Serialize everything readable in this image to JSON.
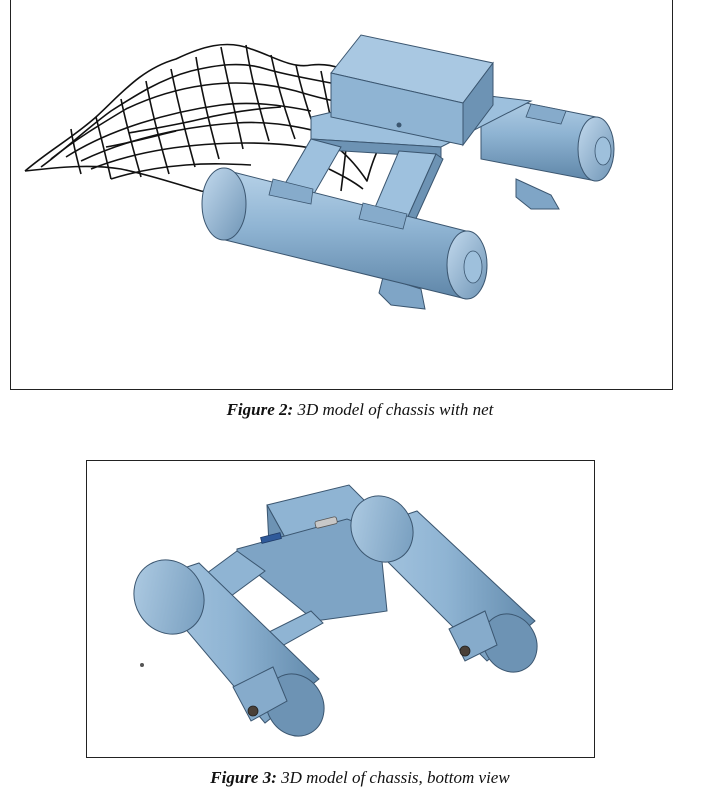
{
  "figures": [
    {
      "label": "Figure 2:",
      "caption": " 3D model of chassis with net"
    },
    {
      "label": "Figure 3:",
      "caption": " 3D model of chassis, bottom view"
    }
  ],
  "colors": {
    "body_fill": "#8fb4d3",
    "body_light": "#a9c8e2",
    "body_dark": "#6d93b4",
    "outline": "#3b5670",
    "net": "#111111"
  }
}
